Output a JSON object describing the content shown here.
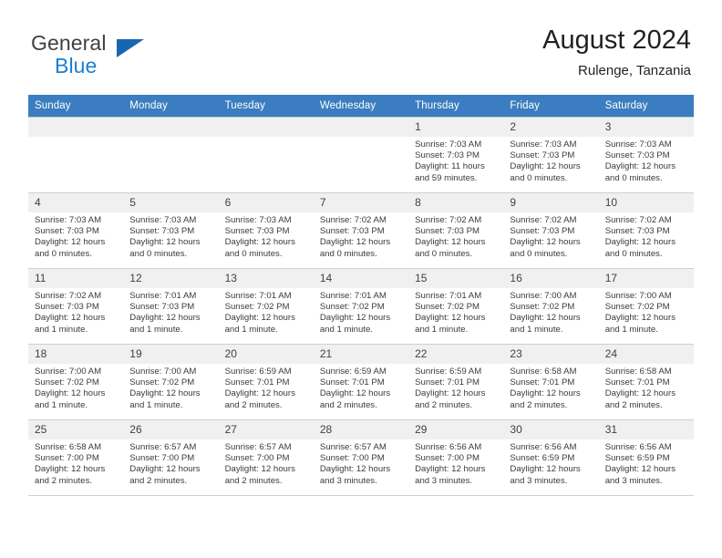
{
  "brand": {
    "line1": "General",
    "line2": "Blue",
    "logo_icon": "triangle-flag-icon"
  },
  "header": {
    "title": "August 2024",
    "subtitle": "Rulenge, Tanzania"
  },
  "calendar": {
    "weekday_headers": [
      "Sunday",
      "Monday",
      "Tuesday",
      "Wednesday",
      "Thursday",
      "Friday",
      "Saturday"
    ],
    "header_bg": "#3b7dc0",
    "daynum_bg": "#f0f0f0",
    "weeks": [
      [
        {
          "day": "",
          "empty": true,
          "sunrise": "",
          "sunset": "",
          "daylight1": "",
          "daylight2": ""
        },
        {
          "day": "",
          "empty": true,
          "sunrise": "",
          "sunset": "",
          "daylight1": "",
          "daylight2": ""
        },
        {
          "day": "",
          "empty": true,
          "sunrise": "",
          "sunset": "",
          "daylight1": "",
          "daylight2": ""
        },
        {
          "day": "",
          "empty": true,
          "sunrise": "",
          "sunset": "",
          "daylight1": "",
          "daylight2": ""
        },
        {
          "day": "1",
          "empty": false,
          "sunrise": "Sunrise: 7:03 AM",
          "sunset": "Sunset: 7:03 PM",
          "daylight1": "Daylight: 11 hours",
          "daylight2": "and 59 minutes."
        },
        {
          "day": "2",
          "empty": false,
          "sunrise": "Sunrise: 7:03 AM",
          "sunset": "Sunset: 7:03 PM",
          "daylight1": "Daylight: 12 hours",
          "daylight2": "and 0 minutes."
        },
        {
          "day": "3",
          "empty": false,
          "sunrise": "Sunrise: 7:03 AM",
          "sunset": "Sunset: 7:03 PM",
          "daylight1": "Daylight: 12 hours",
          "daylight2": "and 0 minutes."
        }
      ],
      [
        {
          "day": "4",
          "empty": false,
          "sunrise": "Sunrise: 7:03 AM",
          "sunset": "Sunset: 7:03 PM",
          "daylight1": "Daylight: 12 hours",
          "daylight2": "and 0 minutes."
        },
        {
          "day": "5",
          "empty": false,
          "sunrise": "Sunrise: 7:03 AM",
          "sunset": "Sunset: 7:03 PM",
          "daylight1": "Daylight: 12 hours",
          "daylight2": "and 0 minutes."
        },
        {
          "day": "6",
          "empty": false,
          "sunrise": "Sunrise: 7:03 AM",
          "sunset": "Sunset: 7:03 PM",
          "daylight1": "Daylight: 12 hours",
          "daylight2": "and 0 minutes."
        },
        {
          "day": "7",
          "empty": false,
          "sunrise": "Sunrise: 7:02 AM",
          "sunset": "Sunset: 7:03 PM",
          "daylight1": "Daylight: 12 hours",
          "daylight2": "and 0 minutes."
        },
        {
          "day": "8",
          "empty": false,
          "sunrise": "Sunrise: 7:02 AM",
          "sunset": "Sunset: 7:03 PM",
          "daylight1": "Daylight: 12 hours",
          "daylight2": "and 0 minutes."
        },
        {
          "day": "9",
          "empty": false,
          "sunrise": "Sunrise: 7:02 AM",
          "sunset": "Sunset: 7:03 PM",
          "daylight1": "Daylight: 12 hours",
          "daylight2": "and 0 minutes."
        },
        {
          "day": "10",
          "empty": false,
          "sunrise": "Sunrise: 7:02 AM",
          "sunset": "Sunset: 7:03 PM",
          "daylight1": "Daylight: 12 hours",
          "daylight2": "and 0 minutes."
        }
      ],
      [
        {
          "day": "11",
          "empty": false,
          "sunrise": "Sunrise: 7:02 AM",
          "sunset": "Sunset: 7:03 PM",
          "daylight1": "Daylight: 12 hours",
          "daylight2": "and 1 minute."
        },
        {
          "day": "12",
          "empty": false,
          "sunrise": "Sunrise: 7:01 AM",
          "sunset": "Sunset: 7:03 PM",
          "daylight1": "Daylight: 12 hours",
          "daylight2": "and 1 minute."
        },
        {
          "day": "13",
          "empty": false,
          "sunrise": "Sunrise: 7:01 AM",
          "sunset": "Sunset: 7:02 PM",
          "daylight1": "Daylight: 12 hours",
          "daylight2": "and 1 minute."
        },
        {
          "day": "14",
          "empty": false,
          "sunrise": "Sunrise: 7:01 AM",
          "sunset": "Sunset: 7:02 PM",
          "daylight1": "Daylight: 12 hours",
          "daylight2": "and 1 minute."
        },
        {
          "day": "15",
          "empty": false,
          "sunrise": "Sunrise: 7:01 AM",
          "sunset": "Sunset: 7:02 PM",
          "daylight1": "Daylight: 12 hours",
          "daylight2": "and 1 minute."
        },
        {
          "day": "16",
          "empty": false,
          "sunrise": "Sunrise: 7:00 AM",
          "sunset": "Sunset: 7:02 PM",
          "daylight1": "Daylight: 12 hours",
          "daylight2": "and 1 minute."
        },
        {
          "day": "17",
          "empty": false,
          "sunrise": "Sunrise: 7:00 AM",
          "sunset": "Sunset: 7:02 PM",
          "daylight1": "Daylight: 12 hours",
          "daylight2": "and 1 minute."
        }
      ],
      [
        {
          "day": "18",
          "empty": false,
          "sunrise": "Sunrise: 7:00 AM",
          "sunset": "Sunset: 7:02 PM",
          "daylight1": "Daylight: 12 hours",
          "daylight2": "and 1 minute."
        },
        {
          "day": "19",
          "empty": false,
          "sunrise": "Sunrise: 7:00 AM",
          "sunset": "Sunset: 7:02 PM",
          "daylight1": "Daylight: 12 hours",
          "daylight2": "and 1 minute."
        },
        {
          "day": "20",
          "empty": false,
          "sunrise": "Sunrise: 6:59 AM",
          "sunset": "Sunset: 7:01 PM",
          "daylight1": "Daylight: 12 hours",
          "daylight2": "and 2 minutes."
        },
        {
          "day": "21",
          "empty": false,
          "sunrise": "Sunrise: 6:59 AM",
          "sunset": "Sunset: 7:01 PM",
          "daylight1": "Daylight: 12 hours",
          "daylight2": "and 2 minutes."
        },
        {
          "day": "22",
          "empty": false,
          "sunrise": "Sunrise: 6:59 AM",
          "sunset": "Sunset: 7:01 PM",
          "daylight1": "Daylight: 12 hours",
          "daylight2": "and 2 minutes."
        },
        {
          "day": "23",
          "empty": false,
          "sunrise": "Sunrise: 6:58 AM",
          "sunset": "Sunset: 7:01 PM",
          "daylight1": "Daylight: 12 hours",
          "daylight2": "and 2 minutes."
        },
        {
          "day": "24",
          "empty": false,
          "sunrise": "Sunrise: 6:58 AM",
          "sunset": "Sunset: 7:01 PM",
          "daylight1": "Daylight: 12 hours",
          "daylight2": "and 2 minutes."
        }
      ],
      [
        {
          "day": "25",
          "empty": false,
          "sunrise": "Sunrise: 6:58 AM",
          "sunset": "Sunset: 7:00 PM",
          "daylight1": "Daylight: 12 hours",
          "daylight2": "and 2 minutes."
        },
        {
          "day": "26",
          "empty": false,
          "sunrise": "Sunrise: 6:57 AM",
          "sunset": "Sunset: 7:00 PM",
          "daylight1": "Daylight: 12 hours",
          "daylight2": "and 2 minutes."
        },
        {
          "day": "27",
          "empty": false,
          "sunrise": "Sunrise: 6:57 AM",
          "sunset": "Sunset: 7:00 PM",
          "daylight1": "Daylight: 12 hours",
          "daylight2": "and 2 minutes."
        },
        {
          "day": "28",
          "empty": false,
          "sunrise": "Sunrise: 6:57 AM",
          "sunset": "Sunset: 7:00 PM",
          "daylight1": "Daylight: 12 hours",
          "daylight2": "and 3 minutes."
        },
        {
          "day": "29",
          "empty": false,
          "sunrise": "Sunrise: 6:56 AM",
          "sunset": "Sunset: 7:00 PM",
          "daylight1": "Daylight: 12 hours",
          "daylight2": "and 3 minutes."
        },
        {
          "day": "30",
          "empty": false,
          "sunrise": "Sunrise: 6:56 AM",
          "sunset": "Sunset: 6:59 PM",
          "daylight1": "Daylight: 12 hours",
          "daylight2": "and 3 minutes."
        },
        {
          "day": "31",
          "empty": false,
          "sunrise": "Sunrise: 6:56 AM",
          "sunset": "Sunset: 6:59 PM",
          "daylight1": "Daylight: 12 hours",
          "daylight2": "and 3 minutes."
        }
      ]
    ]
  }
}
